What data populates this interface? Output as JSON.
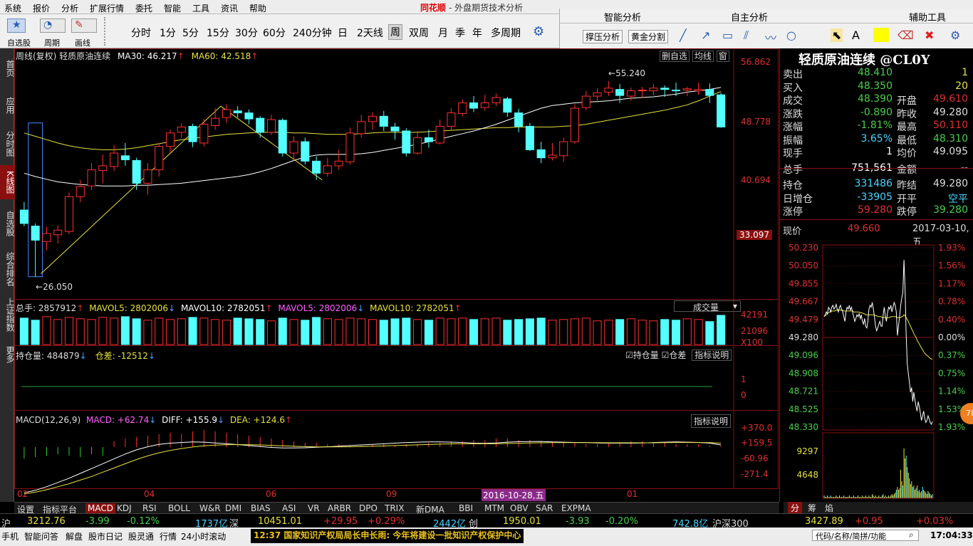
{
  "menu": [
    "系统",
    "报价",
    "分析",
    "扩展行情",
    "委托",
    "智能",
    "工具",
    "资讯",
    "帮助"
  ],
  "app_title": {
    "brand": "同花顺",
    "title": "- 外盘期货技术分析"
  },
  "toolbar": {
    "left_labels": [
      "自选股",
      "周期",
      "画线"
    ],
    "periods": [
      "分时",
      "1分",
      "5分",
      "15分",
      "30分",
      "60分",
      "240分钟",
      "日",
      "2天线",
      "周",
      "双周",
      "月",
      "季",
      "年",
      "多周期"
    ],
    "active_period": "周"
  },
  "right_panel": {
    "heads": [
      "智能分析",
      "自主分析",
      "辅助工具"
    ],
    "buttons": [
      "撑压分析",
      "黄金分割"
    ]
  },
  "leftbar": [
    "首页",
    "应用",
    "分时图",
    "K线图",
    "自选股",
    "综合排名",
    "上证指数",
    "更多"
  ],
  "main": {
    "title": "周线(复权)  轻质原油连续",
    "ma30": "MA30: 46.217",
    "ma60": "MA60: 42.518",
    "right_btns": [
      "删自选",
      "均线",
      "窗"
    ],
    "y_labels": [
      "56.862",
      "48.778",
      "40.694",
      "33.097"
    ],
    "high_label": "55.240",
    "low_label": "26.050"
  },
  "volume": {
    "vol": "总手: 2857912",
    "mavol5": "MAVOL5: 2802006",
    "mavol10": "MAVOL10: 2782051",
    "mavol5b": "MAVOL5: 2802006",
    "mavol10b": "MAVOL10: 2782051",
    "dropdown": "成交量",
    "y_labels": [
      "42191",
      "21096",
      "X100"
    ]
  },
  "oi": {
    "label": "持仓量: 484879",
    "diff": "仓差: -12512",
    "check1": "持仓量",
    "check2": "仓差",
    "btn": "指标说明",
    "y_labels": [
      "1",
      "0",
      "-0"
    ]
  },
  "macd": {
    "label": "MACD(12,26,9)",
    "macd": "MACD: +62.74",
    "diff": "DIFF: +155.9",
    "dea": "DEA: +124.6",
    "btn": "指标说明",
    "y_labels": [
      "+370.0",
      "+159.5",
      "-60.96",
      "-271.4"
    ]
  },
  "x_axis": {
    "labels": [
      "02",
      "04",
      "06",
      "09",
      "01"
    ],
    "cursor_date": "2016-10-28,五"
  },
  "quote": {
    "title": "轻质原油连续 @CL0Y",
    "rows": [
      {
        "l": "卖出",
        "v": "48.410",
        "r": "",
        "rv": "1"
      },
      {
        "l": "买入",
        "v": "48.350",
        "r": "",
        "rv": "20"
      },
      {
        "l": "成交",
        "v": "48.390",
        "r": "开盘",
        "rv": "49.610"
      },
      {
        "l": "涨跌",
        "v": "-0.890",
        "r": "昨收",
        "rv": "49.280"
      },
      {
        "l": "涨幅",
        "v": "-1.81%",
        "r": "最高",
        "rv": "50.110"
      },
      {
        "l": "振幅",
        "v": "3.65%",
        "r": "最低",
        "rv": "48.310"
      },
      {
        "l": "现手",
        "v": "1",
        "r": "均价",
        "rv": "49.095"
      },
      {
        "l": "总手",
        "v": "751,561",
        "r": "金额",
        "rv": "--"
      },
      {
        "l": "持仓",
        "v": "331486",
        "r": "昨结",
        "rv": "49.280"
      },
      {
        "l": "日增仓",
        "v": "-33905",
        "r": "开平",
        "rv": "空平"
      },
      {
        "l": "涨停",
        "v": "59.280",
        "r": "跌停",
        "rv": "39.280"
      }
    ],
    "now_label": "现价",
    "now_price": "49.660",
    "now_date": "2017-03-10,五",
    "mini_prices": [
      "50.230",
      "50.050",
      "49.855",
      "49.667",
      "49.479",
      "49.280",
      "49.096",
      "48.908",
      "48.721",
      "48.525",
      "48.330",
      "9297",
      "4648"
    ],
    "mini_pcts": [
      "1.93%",
      "1.56%",
      "1.17%",
      "0.78%",
      "0.40%",
      "0.00%",
      "0.37%",
      "0.75%",
      "1.14%",
      "1.53%",
      "1.93%"
    ],
    "tabs": [
      "分",
      "筹",
      "焰"
    ],
    "badge": "78"
  },
  "indicator_tabs": [
    "设置",
    "指标平台",
    "MACD",
    "KDJ",
    "RSI",
    "BOLL",
    "W&R",
    "DMI",
    "BIAS",
    "ASI",
    "VR",
    "ARBR",
    "DPO",
    "TRIX",
    "新DMA",
    "BBI",
    "MTM",
    "OBV",
    "SAR",
    "EXPMA"
  ],
  "active_indicator": "MACD",
  "index_bar": {
    "sh_label": "沪",
    "sh_val": "3212.76",
    "sh_chg": "-3.99",
    "sh_pct": "-0.12%",
    "sh_amt": "1737亿",
    "sz_label": "深",
    "sz_val": "10451.01",
    "sz_chg": "+29.95",
    "sz_pct": "+0.29%",
    "sz_amt": "2442亿",
    "cy_label": "创",
    "cy_val": "1950.01",
    "cy_chg": "-3.93",
    "cy_pct": "-0.20%",
    "cy_amt": "742.8亿",
    "hs_label": "沪深300",
    "hs_val": "3427.89",
    "hs_chg": "+0.95",
    "hs_pct": "+0.03%"
  },
  "status": {
    "items": [
      "手机",
      "智能问答",
      "解盘",
      "股市日记",
      "股灵通",
      "行情",
      "24小时滚动"
    ],
    "news": "12:37 国家知识产权局局长申长雨: 今年将建设一批知识产权保护中心",
    "search": "代码/名称/简拼/功能",
    "time": "17:04:33"
  },
  "chart_data": {
    "type": "candlestick",
    "candles": [
      [
        36.0,
        34.0,
        37.2,
        33.6
      ],
      [
        33.6,
        31.5,
        34.0,
        26.05
      ],
      [
        31.3,
        32.5,
        33.5,
        30.0
      ],
      [
        32.3,
        33.0,
        33.7,
        31.0
      ],
      [
        32.8,
        38.0,
        38.6,
        32.4
      ],
      [
        38.0,
        39.5,
        40.5,
        37.2
      ],
      [
        39.6,
        42.0,
        43.0,
        39.0
      ],
      [
        41.9,
        42.6,
        44.3,
        40.0
      ],
      [
        42.5,
        44.5,
        45.7,
        41.8
      ],
      [
        44.1,
        43.5,
        46.0,
        42.6
      ],
      [
        43.4,
        40.0,
        43.8,
        39.0
      ],
      [
        40.0,
        42.0,
        43.0,
        38.3
      ],
      [
        42.0,
        45.5,
        46.0,
        41.0
      ],
      [
        45.5,
        47.5,
        48.0,
        44.5
      ],
      [
        47.6,
        48.4,
        49.0,
        46.8
      ],
      [
        48.5,
        46.2,
        48.9,
        45.4
      ],
      [
        46.0,
        48.8,
        49.6,
        45.5
      ],
      [
        48.6,
        49.7,
        51.2,
        48.0
      ],
      [
        49.8,
        51.0,
        51.8,
        49.0
      ],
      [
        50.8,
        50.5,
        51.5,
        49.8
      ],
      [
        50.5,
        49.6,
        51.0,
        48.8
      ],
      [
        49.7,
        47.6,
        50.0,
        46.8
      ],
      [
        47.6,
        49.5,
        50.2,
        47.2
      ],
      [
        49.4,
        44.5,
        49.7,
        44.0
      ],
      [
        44.5,
        46.2,
        47.0,
        43.5
      ],
      [
        46.2,
        43.3,
        46.8,
        42.8
      ],
      [
        43.3,
        41.5,
        44.0,
        40.5
      ],
      [
        41.5,
        42.6,
        43.8,
        41.0
      ],
      [
        42.6,
        43.3,
        45.0,
        42.0
      ],
      [
        43.2,
        47.5,
        48.3,
        42.8
      ],
      [
        47.4,
        49.2,
        50.2,
        46.8
      ],
      [
        49.2,
        50.0,
        50.6,
        48.0
      ],
      [
        50.0,
        48.5,
        50.8,
        47.8
      ],
      [
        48.4,
        47.8,
        49.0,
        46.5
      ],
      [
        47.8,
        44.5,
        48.2,
        44.0
      ],
      [
        44.5,
        46.8,
        47.8,
        44.3
      ],
      [
        46.8,
        46.2,
        48.0,
        45.3
      ],
      [
        46.0,
        48.5,
        49.5,
        45.8
      ],
      [
        48.5,
        50.5,
        51.2,
        48.0
      ],
      [
        50.4,
        52.0,
        52.5,
        50.0
      ],
      [
        52.0,
        51.2,
        53.0,
        50.6
      ],
      [
        51.3,
        52.0,
        53.2,
        50.8
      ],
      [
        52.0,
        52.8,
        53.4,
        51.5
      ],
      [
        52.6,
        50.6,
        52.9,
        49.9
      ],
      [
        50.5,
        48.5,
        51.1,
        47.6
      ],
      [
        48.5,
        45.0,
        49.0,
        44.8
      ],
      [
        45.0,
        43.8,
        46.2,
        43.0
      ],
      [
        43.8,
        44.2,
        46.0,
        43.4
      ],
      [
        44.1,
        46.2,
        46.8,
        43.2
      ],
      [
        46.2,
        51.2,
        51.8,
        45.9
      ],
      [
        51.3,
        53.0,
        53.8,
        50.9
      ],
      [
        53.0,
        53.5,
        54.2,
        52.0
      ],
      [
        53.6,
        54.2,
        55.24,
        53.0
      ],
      [
        54.0,
        53.1,
        54.8,
        52.0
      ],
      [
        53.0,
        53.8,
        54.3,
        52.3
      ],
      [
        53.8,
        53.9,
        54.4,
        52.8
      ],
      [
        53.8,
        54.2,
        54.8,
        53.1
      ],
      [
        54.2,
        54.0,
        54.6,
        52.9
      ],
      [
        53.9,
        53.8,
        55.0,
        53.0
      ],
      [
        53.9,
        54.1,
        54.4,
        53.0
      ],
      [
        53.8,
        54.0,
        55.0,
        53.2
      ],
      [
        54.0,
        53.1,
        54.9,
        52.0
      ],
      [
        53.2,
        48.4,
        53.5,
        48.3
      ]
    ],
    "ma_yellow": [
      47.5,
      47.0,
      46.5,
      46.0,
      45.6,
      45.3,
      45.1,
      45.0,
      45.0,
      45.1,
      45.3,
      45.6,
      45.9,
      46.2,
      46.5,
      46.7,
      46.9,
      47.1,
      47.3,
      47.4,
      47.5,
      47.6,
      47.6,
      47.6,
      47.5,
      47.5,
      47.4,
      47.3,
      47.3,
      47.3,
      47.4,
      47.5,
      47.6,
      47.6,
      47.6,
      47.6,
      47.7,
      47.8,
      47.9,
      48.0,
      48.1,
      48.2,
      48.3,
      48.3,
      48.4,
      48.4,
      48.4,
      48.4,
      48.5,
      48.6,
      48.8,
      49.1,
      49.4,
      49.7,
      50.0,
      50.3,
      50.6,
      50.9,
      51.3,
      51.7,
      52.3,
      53.0,
      53.7
    ],
    "ma_white": [
      41.5,
      41.0,
      40.6,
      40.2,
      40.0,
      39.8,
      39.7,
      39.6,
      39.6,
      39.6,
      39.7,
      39.7,
      39.8,
      39.9,
      40.0,
      40.2,
      40.4,
      40.6,
      40.8,
      41.0,
      41.3,
      41.7,
      42.2,
      42.8,
      43.4,
      43.9,
      44.2,
      44.3,
      44.3,
      44.3,
      44.4,
      44.6,
      44.9,
      45.2,
      45.5,
      45.8,
      46.2,
      46.6,
      47.0,
      47.4,
      47.8,
      48.3,
      48.8,
      49.4,
      50.0,
      50.6,
      51.2,
      51.6,
      51.8,
      52.0,
      52.1,
      52.2,
      52.3,
      52.5,
      52.7,
      52.8,
      52.9,
      53.1,
      53.3,
      53.6,
      53.8,
      54.0,
      54.3
    ],
    "volume": [
      38,
      35,
      40,
      36,
      39,
      37,
      36,
      39,
      38,
      40,
      37,
      35,
      38,
      36,
      37,
      39,
      38,
      36,
      35,
      38,
      37,
      36,
      34,
      38,
      36,
      35,
      39,
      37,
      36,
      38,
      37,
      36,
      35,
      37,
      38,
      36,
      35,
      38,
      37,
      38,
      36,
      37,
      38,
      35,
      36,
      37,
      38,
      35,
      36,
      37,
      38,
      34,
      35,
      36,
      37,
      35,
      34,
      36,
      35,
      37,
      36,
      33,
      42
    ],
    "macd_hist": [
      -8,
      -7,
      -6,
      -5,
      -6,
      -7,
      -5,
      -6,
      4,
      6,
      7,
      8,
      9,
      10,
      9,
      11,
      12,
      11,
      10,
      9,
      8,
      7,
      6,
      5,
      4,
      3,
      3,
      2,
      2,
      1,
      1,
      2,
      2,
      1,
      2,
      2,
      3,
      3,
      4,
      4,
      5,
      5,
      6,
      6,
      5,
      5,
      4,
      4,
      3,
      3,
      2,
      2,
      3,
      3,
      4,
      4,
      3,
      3,
      2,
      2,
      2,
      1,
      1
    ],
    "macd_diff": [
      -260,
      -240,
      -210,
      -175,
      -140,
      -100,
      -60,
      -20,
      20,
      60,
      95,
      120,
      140,
      150,
      155,
      160,
      158,
      152,
      145,
      138,
      130,
      122,
      115,
      110,
      110,
      112,
      116,
      120,
      125,
      130,
      135,
      140,
      145,
      150,
      155,
      158,
      160,
      160,
      158,
      155,
      150,
      148,
      152,
      158,
      162,
      163,
      164,
      160,
      158,
      156,
      155,
      152,
      150,
      150,
      150,
      152,
      155,
      158,
      160,
      158,
      156,
      150,
      135
    ],
    "macd_dea": [
      -270,
      -255,
      -235,
      -210,
      -185,
      -155,
      -125,
      -90,
      -55,
      -20,
      15,
      45,
      70,
      90,
      105,
      118,
      128,
      134,
      137,
      138,
      137,
      135,
      132,
      128,
      124,
      121,
      119,
      119,
      119,
      120,
      122,
      124,
      127,
      130,
      133,
      136,
      139,
      142,
      144,
      145,
      145,
      145,
      145,
      147,
      149,
      151,
      153,
      154,
      154,
      154,
      154,
      154,
      153,
      153,
      153,
      153,
      153,
      154,
      155,
      155,
      155,
      154,
      150
    ],
    "minute_price": [
      49.5,
      49.52,
      49.55,
      49.53,
      49.6,
      49.58,
      49.55,
      49.6,
      49.62,
      49.58,
      49.6,
      49.63,
      49.58,
      49.55,
      49.6,
      49.62,
      49.57,
      49.55,
      49.5,
      49.45,
      49.55,
      49.6,
      49.58,
      49.62,
      49.57,
      49.6,
      49.55,
      49.5,
      49.45,
      49.48,
      49.52,
      49.5,
      49.53,
      49.48,
      49.52,
      49.45,
      49.42,
      49.48,
      49.4,
      49.38,
      49.45,
      49.58,
      49.62,
      49.6,
      49.65,
      49.58,
      49.5,
      49.4,
      49.35,
      49.38,
      49.42,
      49.45,
      49.4,
      49.4,
      49.52,
      49.6,
      49.5,
      49.45,
      49.55,
      49.6,
      49.58,
      49.62,
      49.55,
      49.6,
      49.65,
      49.62,
      49.55,
      49.3,
      49.4,
      49.5,
      49.62,
      49.7,
      49.75,
      50.1,
      49.8,
      49.3,
      49.0,
      48.9,
      48.8,
      48.7,
      48.75,
      48.6,
      48.7,
      48.62,
      48.55,
      48.5,
      48.6,
      48.55,
      48.48,
      48.4,
      48.45,
      48.5,
      48.42,
      48.38,
      48.4,
      48.45,
      48.42,
      48.38,
      48.36,
      48.39
    ],
    "minute_avg": [
      49.5,
      49.51,
      49.52,
      49.53,
      49.54,
      49.55,
      49.55,
      49.56,
      49.56,
      49.56,
      49.56,
      49.57,
      49.57,
      49.57,
      49.57,
      49.57,
      49.57,
      49.57,
      49.56,
      49.56,
      49.56,
      49.56,
      49.56,
      49.56,
      49.56,
      49.56,
      49.56,
      49.55,
      49.55,
      49.55,
      49.55,
      49.55,
      49.55,
      49.54,
      49.54,
      49.54,
      49.53,
      49.53,
      49.52,
      49.52,
      49.52,
      49.52,
      49.52,
      49.52,
      49.52,
      49.52,
      49.52,
      49.51,
      49.51,
      49.5,
      49.5,
      49.5,
      49.5,
      49.49,
      49.49,
      49.49,
      49.49,
      49.49,
      49.49,
      49.49,
      49.49,
      49.5,
      49.5,
      49.5,
      49.5,
      49.5,
      49.5,
      49.49,
      49.49,
      49.49,
      49.49,
      49.5,
      49.5,
      49.52,
      49.51,
      49.49,
      49.47,
      49.45,
      49.42,
      49.4,
      49.37,
      49.35,
      49.32,
      49.3,
      49.28,
      49.25,
      49.23,
      49.21,
      49.19,
      49.17,
      49.15,
      49.13,
      49.11,
      49.1,
      49.09,
      49.08,
      49.07,
      49.06,
      49.05,
      49.05
    ],
    "minute_vol": [
      2,
      1,
      1,
      2,
      1,
      1,
      2,
      1,
      1,
      1,
      1,
      2,
      1,
      1,
      2,
      1,
      1,
      1,
      2,
      1,
      1,
      1,
      1,
      2,
      1,
      1,
      1,
      2,
      1,
      1,
      1,
      2,
      1,
      1,
      1,
      2,
      1,
      1,
      2,
      1,
      1,
      2,
      1,
      1,
      3,
      2,
      1,
      2,
      1,
      1,
      2,
      1,
      1,
      2,
      3,
      1,
      2,
      1,
      1,
      2,
      1,
      2,
      3,
      2,
      3,
      4,
      6,
      8,
      6,
      7,
      20,
      12,
      9,
      35,
      28,
      30,
      22,
      18,
      14,
      10,
      12,
      8,
      9,
      6,
      7,
      9,
      5,
      6,
      4,
      5,
      8,
      6,
      5,
      4,
      3,
      5,
      4,
      3,
      2,
      3
    ]
  }
}
